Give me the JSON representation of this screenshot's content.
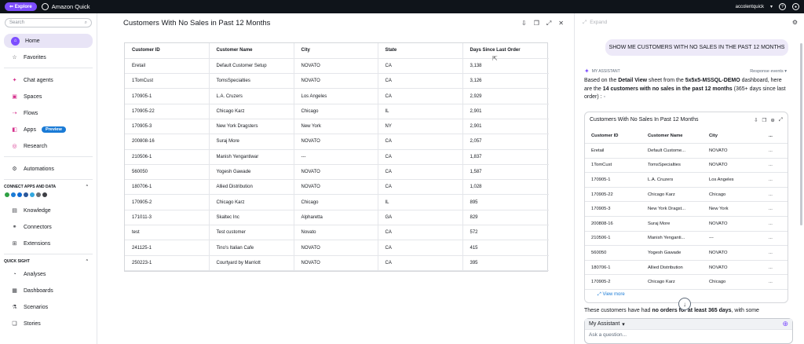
{
  "topbar": {
    "explore_label": "⇐ Explore",
    "app_title": "Amazon Quick",
    "username": "accolentquick"
  },
  "sidebar": {
    "search_placeholder": "Search",
    "nav": [
      {
        "label": "Home",
        "icon": "home-icon"
      },
      {
        "label": "Favorites",
        "icon": "star-icon"
      },
      {
        "label": "Chat agents",
        "icon": "chat-agents-icon"
      },
      {
        "label": "Spaces",
        "icon": "spaces-icon"
      },
      {
        "label": "Flows",
        "icon": "flows-icon"
      },
      {
        "label": "Apps",
        "icon": "apps-icon",
        "badge": "Preview"
      },
      {
        "label": "Research",
        "icon": "research-icon"
      },
      {
        "label": "Automations",
        "icon": "automations-icon"
      }
    ],
    "connect_section": "CONNECT APPS AND DATA",
    "connect_nav": [
      {
        "label": "Knowledge",
        "icon": "knowledge-icon"
      },
      {
        "label": "Connectors",
        "icon": "connectors-icon"
      },
      {
        "label": "Extensions",
        "icon": "extensions-icon"
      }
    ],
    "quicksight_section": "QUICK SIGHT",
    "quicksight_nav": [
      {
        "label": "Analyses",
        "icon": "analyses-icon"
      },
      {
        "label": "Dashboards",
        "icon": "dashboards-icon"
      },
      {
        "label": "Scenarios",
        "icon": "scenarios-icon"
      },
      {
        "label": "Stories",
        "icon": "stories-icon"
      }
    ]
  },
  "main": {
    "title": "Customers With No Sales in Past 12 Months",
    "columns": [
      "Customer ID",
      "Customer Name",
      "City",
      "State",
      "Days Since Last Order"
    ],
    "rows": [
      [
        "Eretail",
        "Default Customer Setup",
        "NOVATO",
        "CA",
        "3,138"
      ],
      [
        "1TomCust",
        "TomsSpecialties",
        "NOVATO",
        "CA",
        "3,126"
      ],
      [
        "170905-1",
        "L.A. Cruzers",
        "Los Angeles",
        "CA",
        "2,929"
      ],
      [
        "170905-22",
        "Chicago Karz",
        "Chicago",
        "IL",
        "2,901"
      ],
      [
        "170905-3",
        "New York Dragsters",
        "New York",
        "NY",
        "2,901"
      ],
      [
        "200808-16",
        "Suraj More",
        "NOVATO",
        "CA",
        "2,057"
      ],
      [
        "210506-1",
        "Manish Yengantiwar",
        "---",
        "CA",
        "1,837"
      ],
      [
        "560050",
        "Yogesh Gawade",
        "NOVATO",
        "CA",
        "1,587"
      ],
      [
        "180706-1",
        "Allied Distribution",
        "NOVATO",
        "CA",
        "1,028"
      ],
      [
        "170905-2",
        "Chicago Karz",
        "Chicago",
        "IL",
        "895"
      ],
      [
        "171011-3",
        "Skaltec Inc",
        "Alpharetta",
        "GA",
        "829"
      ],
      [
        "test",
        "Test customer",
        "Novato",
        "CA",
        "572"
      ],
      [
        "241125-1",
        "Tino's Italian Cafe",
        "NOVATO",
        "CA",
        "415"
      ],
      [
        "250223-1",
        "Courtyard by Marriott",
        "NOVATO",
        "CA",
        "395"
      ]
    ]
  },
  "assistant": {
    "expand_label": "Expand",
    "user_message": "SHOW ME CUSTOMERS WITH NO SALES IN THE PAST 12 MONTHS",
    "assistant_label": "MY ASSISTANT",
    "response_events": "Response events",
    "reply_1": "Based on the ",
    "reply_2": "Detail View",
    "reply_3": " sheet from the ",
    "reply_4": "5x5x5-MSSQL-DEMO",
    "reply_5": " dashboard, here are the ",
    "reply_6": "14 customers with no sales in the past 12 months",
    "reply_7": " (365+ days since last order) :",
    "card_title": "Customers With No Sales In Past 12 Months",
    "card_columns": [
      "Customer ID",
      "Customer Name",
      "City",
      "..."
    ],
    "card_rows": [
      [
        "Eretail",
        "Default Custome...",
        "NOVATO",
        "..."
      ],
      [
        "1TomCust",
        "TomsSpecialties",
        "NOVATO",
        "..."
      ],
      [
        "170905-1",
        "L.A. Cruzers",
        "Los Angeles",
        "..."
      ],
      [
        "170905-22",
        "Chicago Karz",
        "Chicago",
        "..."
      ],
      [
        "170905-3",
        "New York Dragst...",
        "New York",
        "..."
      ],
      [
        "200808-16",
        "Suraj More",
        "NOVATO",
        "..."
      ],
      [
        "210506-1",
        "Manish Yenganti...",
        "---",
        "..."
      ],
      [
        "560050",
        "Yogesh Gawade",
        "NOVATO",
        "..."
      ],
      [
        "180706-1",
        "Allied Distribution",
        "NOVATO",
        "..."
      ],
      [
        "170905-2",
        "Chicago Karz",
        "Chicago",
        "..."
      ]
    ],
    "view_more": "View more",
    "trailing_1": "These customers have had ",
    "trailing_2": "no orders for at least 365 days",
    "trailing_3": ", with some",
    "composer_title": "My Assistant",
    "composer_placeholder": "Ask a question..."
  },
  "colors": {
    "accent": "#7c4dff",
    "topbar": "#0f141a",
    "link": "#1a7bd6",
    "active_nav": "#e8e4f6"
  }
}
